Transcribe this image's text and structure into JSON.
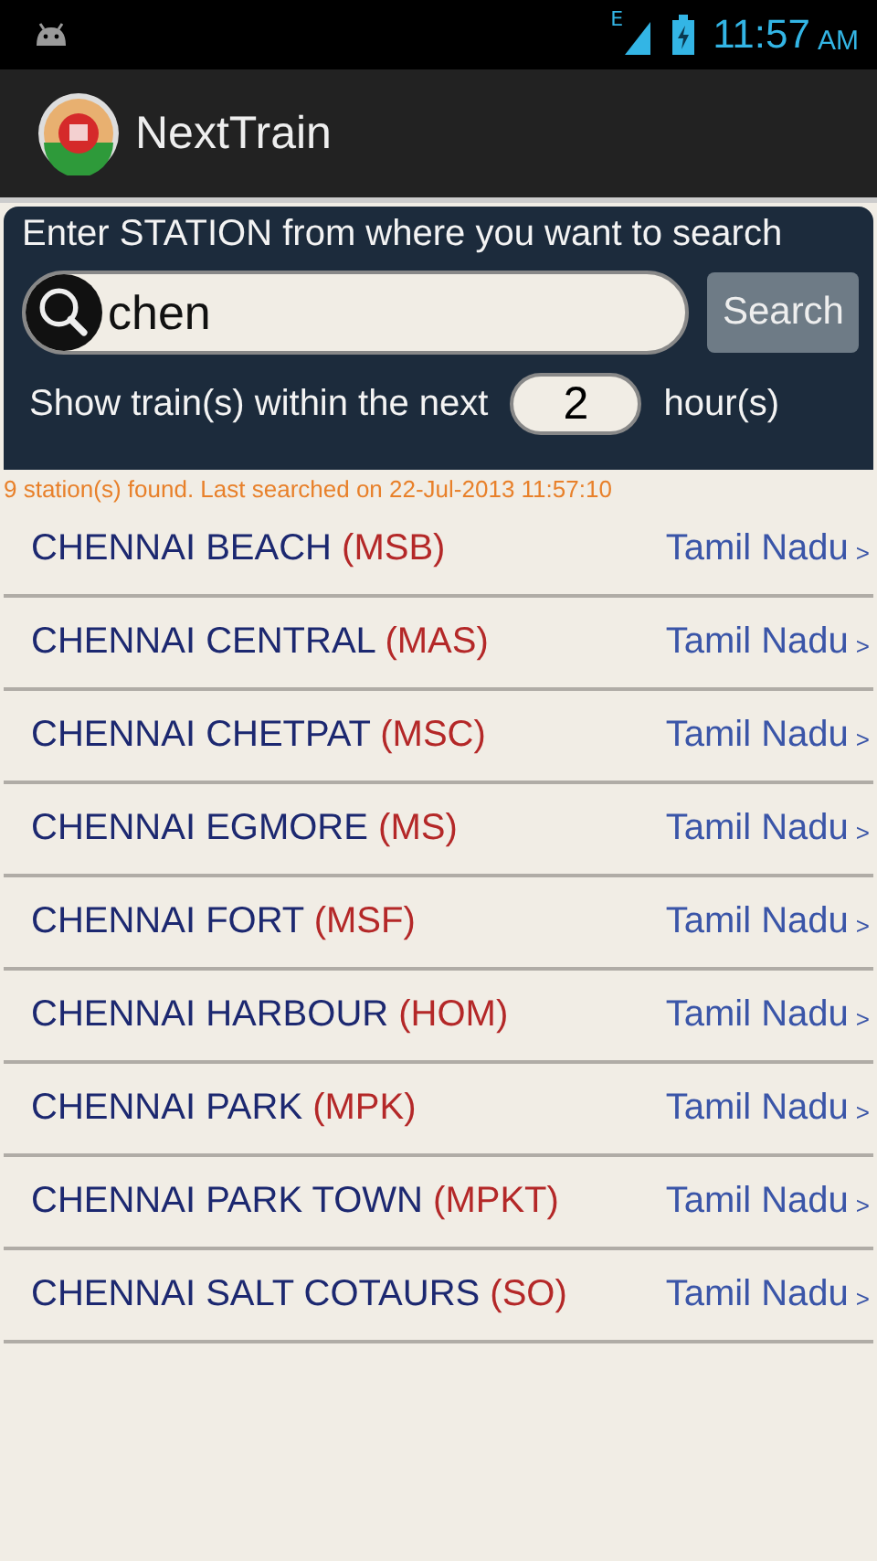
{
  "status_bar": {
    "time": "11:57",
    "ampm": "AM",
    "network": "E"
  },
  "app_bar": {
    "title": "NextTrain"
  },
  "search": {
    "prompt": "Enter STATION from where you want to search",
    "value": "chen",
    "button": "Search",
    "within_label": "Show train(s) within the next",
    "hours": "2",
    "hours_unit": "hour(s)"
  },
  "result_summary": "9 station(s) found. Last searched on 22-Jul-2013 11:57:10",
  "stations": [
    {
      "name": "CHENNAI BEACH",
      "code": "(MSB)",
      "state": "Tamil Nadu",
      "chevron": ">"
    },
    {
      "name": "CHENNAI CENTRAL",
      "code": "(MAS)",
      "state": "Tamil Nadu",
      "chevron": ">"
    },
    {
      "name": "CHENNAI CHETPAT",
      "code": "(MSC)",
      "state": "Tamil Nadu",
      "chevron": ">"
    },
    {
      "name": "CHENNAI EGMORE",
      "code": "(MS)",
      "state": "Tamil Nadu",
      "chevron": ">"
    },
    {
      "name": "CHENNAI FORT",
      "code": "(MSF)",
      "state": "Tamil Nadu",
      "chevron": ">"
    },
    {
      "name": "CHENNAI HARBOUR",
      "code": "(HOM)",
      "state": "Tamil Nadu",
      "chevron": ">"
    },
    {
      "name": "CHENNAI PARK",
      "code": "(MPK)",
      "state": "Tamil Nadu",
      "chevron": ">"
    },
    {
      "name": "CHENNAI PARK TOWN",
      "code": "(MPKT)",
      "state": "Tamil Nadu",
      "chevron": ">"
    },
    {
      "name": "CHENNAI SALT COTAURS",
      "code": "(SO)",
      "state": "Tamil Nadu",
      "chevron": ">"
    }
  ]
}
